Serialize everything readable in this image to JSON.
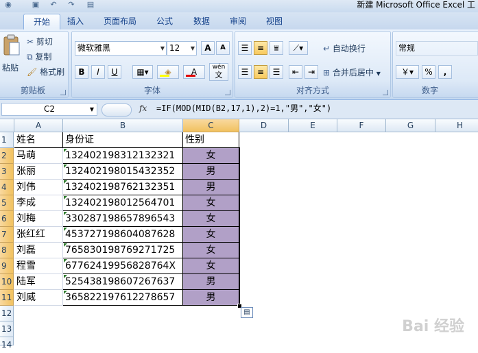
{
  "title": "新建 Microsoft Office Excel 工",
  "tabs": [
    "开始",
    "插入",
    "页面布局",
    "公式",
    "数据",
    "审阅",
    "视图"
  ],
  "active_tab": "开始",
  "clipboard": {
    "paste": "粘贴",
    "cut": "剪切",
    "copy": "复制",
    "format_painter": "格式刷",
    "group_label": "剪贴板"
  },
  "font": {
    "name": "微软雅黑",
    "size": "12",
    "grow": "A",
    "shrink": "A",
    "bold": "B",
    "italic": "I",
    "underline": "U",
    "wen": "wén",
    "wen2": "文",
    "group_label": "字体"
  },
  "alignment": {
    "wrap_text": "自动换行",
    "merge_center": "合并后居中",
    "group_label": "对齐方式"
  },
  "number": {
    "format": "常规",
    "percent": "%",
    "comma": ",",
    "group_label": "数字"
  },
  "formula_bar": {
    "name_box": "C2",
    "fx": "fx",
    "formula": "=IF(MOD(MID(B2,17,1),2)=1,\"男\",\"女\")"
  },
  "columns": [
    "A",
    "B",
    "C",
    "D",
    "E",
    "F",
    "G",
    "H"
  ],
  "rows": [
    "1",
    "2",
    "3",
    "4",
    "5",
    "6",
    "7",
    "8",
    "9",
    "10",
    "11",
    "12",
    "13",
    "14"
  ],
  "table": {
    "headers": [
      "姓名",
      "身份证",
      "性别"
    ],
    "rows": [
      [
        "马萌",
        "132402198312132321",
        "女"
      ],
      [
        "张丽",
        "132402198015432352",
        "男"
      ],
      [
        "刘伟",
        "132402198762132351",
        "男"
      ],
      [
        "李成",
        "132402198012564701",
        "女"
      ],
      [
        "刘梅",
        "330287198657896543",
        "女"
      ],
      [
        "张红红",
        "453727198604087628",
        "女"
      ],
      [
        "刘磊",
        "765830198769271725",
        "女"
      ],
      [
        "程雪",
        "67762419956828764X",
        "女"
      ],
      [
        "陆军",
        "525438198607267637",
        "男"
      ],
      [
        "刘威",
        "365822197612278657",
        "男"
      ]
    ]
  },
  "watermark": "Bai 经验"
}
